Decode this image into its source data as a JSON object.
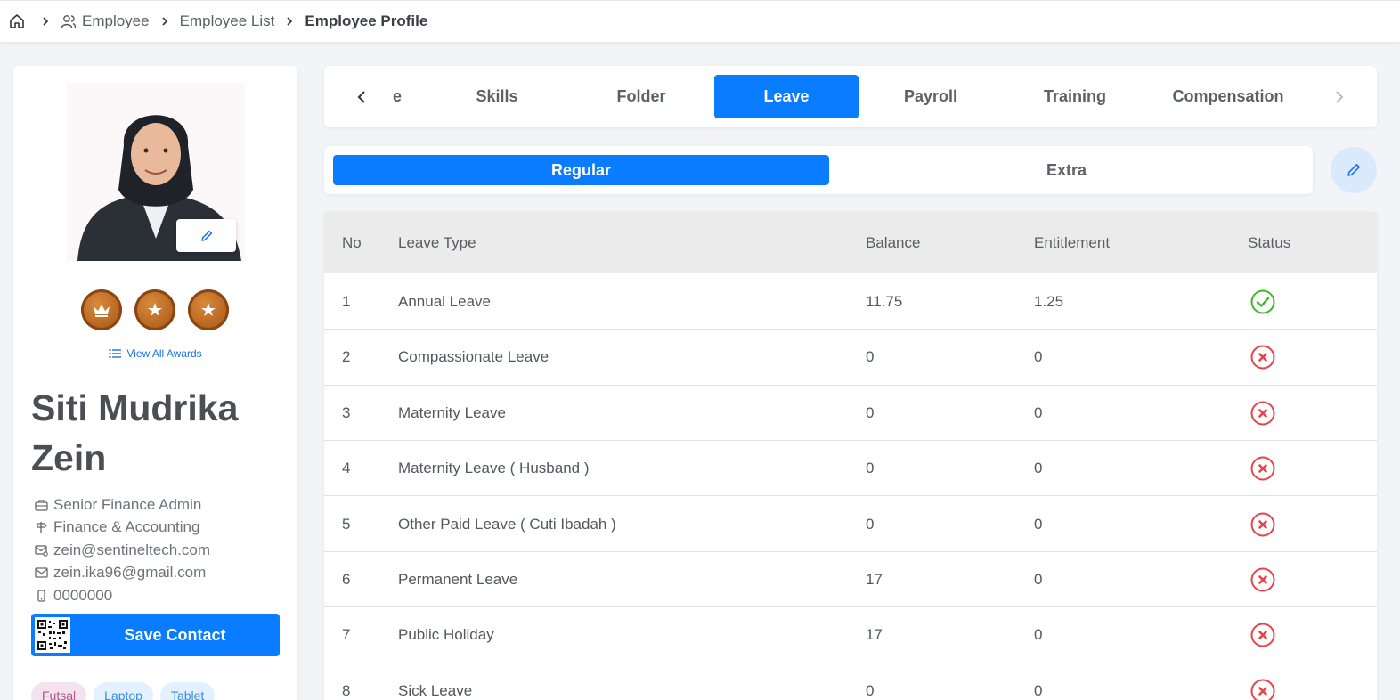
{
  "breadcrumb": {
    "items": [
      "Employee",
      "Employee List"
    ],
    "current": "Employee Profile"
  },
  "profile": {
    "name": "Siti Mudrika Zein",
    "view_awards_label": "View All Awards",
    "awards": [
      "crown-icon",
      "star-icon",
      "star-icon"
    ],
    "job_title": "Senior Finance Admin",
    "department": "Finance & Accounting",
    "work_email": "zein@sentineltech.com",
    "personal_email": "zein.ika96@gmail.com",
    "phone": "0000000",
    "save_contact_label": "Save Contact",
    "tags": [
      "Futsal",
      "Laptop",
      "Tablet"
    ]
  },
  "tabs": {
    "items": [
      "e",
      "Skills",
      "Folder",
      "Leave",
      "Payroll",
      "Training",
      "Compensation"
    ],
    "active": "Leave"
  },
  "subtabs": {
    "items": [
      "Regular",
      "Extra"
    ],
    "active": "Regular"
  },
  "table": {
    "headers": [
      "No",
      "Leave Type",
      "Balance",
      "Entitlement",
      "Status"
    ],
    "rows": [
      {
        "no": "1",
        "type": "Annual Leave",
        "balance": "11.75",
        "entitlement": "1.25",
        "status": "active"
      },
      {
        "no": "2",
        "type": "Compassionate Leave",
        "balance": "0",
        "entitlement": "0",
        "status": "inactive"
      },
      {
        "no": "3",
        "type": "Maternity Leave",
        "balance": "0",
        "entitlement": "0",
        "status": "inactive"
      },
      {
        "no": "4",
        "type": "Maternity Leave ( Husband )",
        "balance": "0",
        "entitlement": "0",
        "status": "inactive"
      },
      {
        "no": "5",
        "type": "Other Paid Leave ( Cuti Ibadah )",
        "balance": "0",
        "entitlement": "0",
        "status": "inactive"
      },
      {
        "no": "6",
        "type": "Permanent Leave",
        "balance": "17",
        "entitlement": "0",
        "status": "inactive"
      },
      {
        "no": "7",
        "type": "Public Holiday",
        "balance": "17",
        "entitlement": "0",
        "status": "inactive"
      },
      {
        "no": "8",
        "type": "Sick Leave",
        "balance": "0",
        "entitlement": "0",
        "status": "inactive"
      }
    ]
  },
  "colors": {
    "primary": "#0a7cff",
    "status_active": "#3fb628",
    "status_inactive": "#e8424a"
  }
}
